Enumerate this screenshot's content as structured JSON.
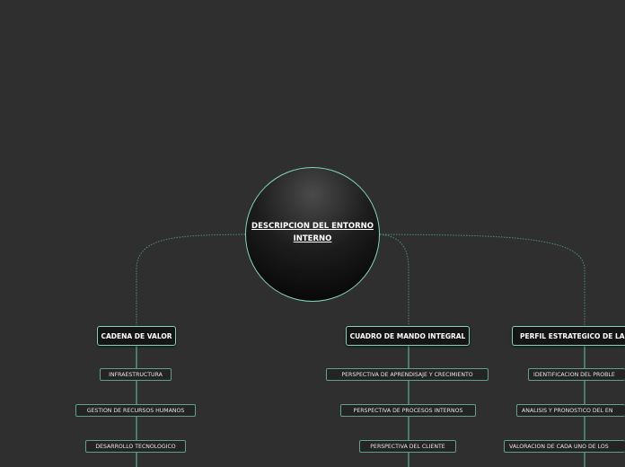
{
  "root": {
    "label": "DESCRIPCION DEL ENTORNO INTERNO"
  },
  "branches": [
    {
      "label": "CADENA DE VALOR",
      "children": [
        "INFRAESTRUCTURA",
        "GESTION DE RECURSOS HUMANOS",
        "DESARROLLO TECNOLOGICO"
      ]
    },
    {
      "label": "CUADRO DE MANDO INTEGRAL",
      "children": [
        "PERSPECTIVA DE APRENDISAJE Y CRECIMIENTO",
        "PERSPECTIVA DE PROCESOS INTERNOS",
        "PERSPECTIVA DEL CLIENTE"
      ]
    },
    {
      "label": "PERFIL ESTRATEGICO DE LA EM",
      "children": [
        "IDENTIFICACION DEL PROBLE",
        "ANALISIS Y PRONOSTICO DEL EN",
        "VALORACION DE CADA UNO DE LOS"
      ]
    }
  ],
  "colors": {
    "background": "#2f2f2f",
    "accent": "#7fd6bd",
    "connector": "#4f8f7d"
  }
}
